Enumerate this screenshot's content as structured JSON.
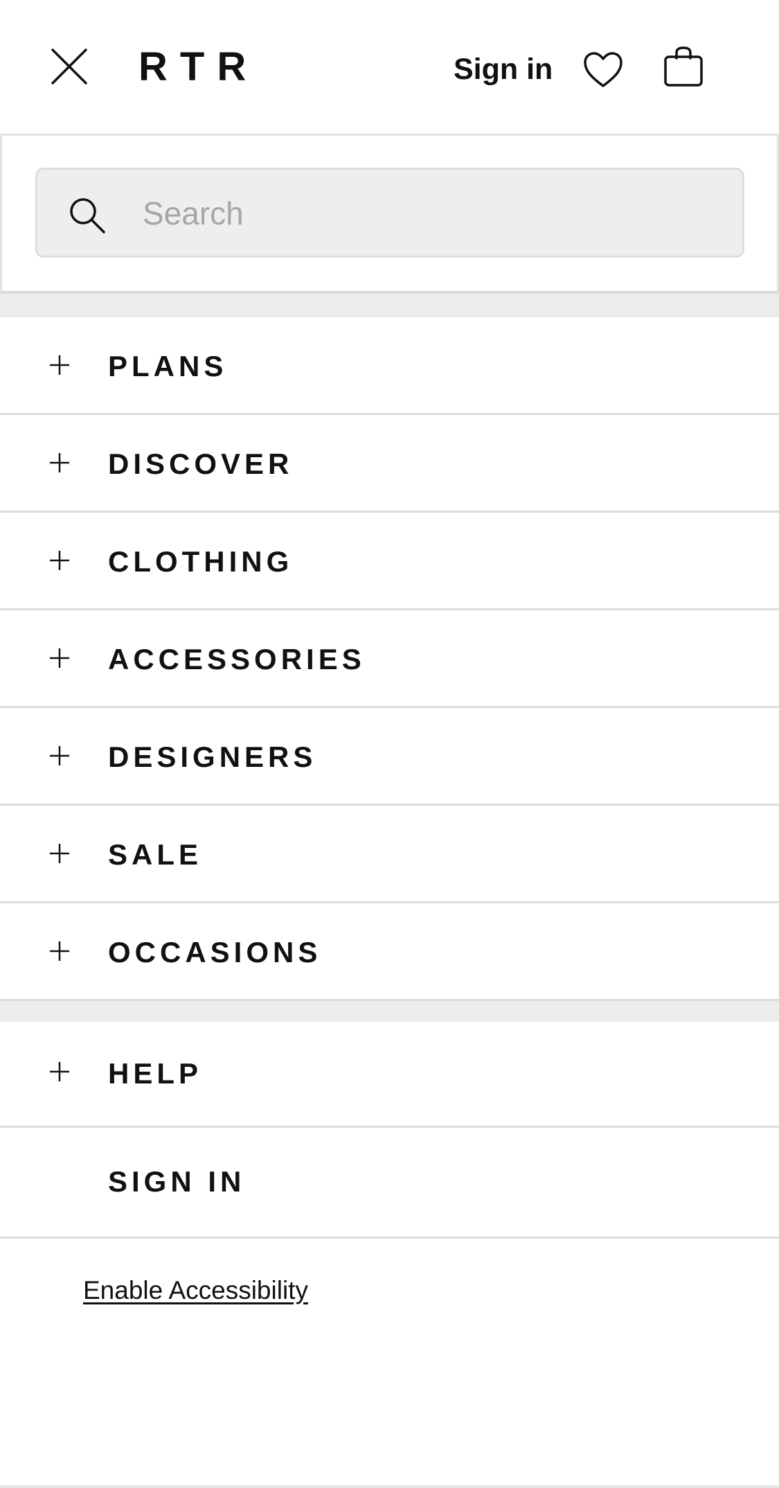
{
  "header": {
    "logo": "RTR",
    "sign_in_link": "Sign in",
    "icons": {
      "close": "close-icon",
      "favorites": "heart-icon",
      "bag": "shopping-bag-icon"
    }
  },
  "search": {
    "placeholder": "Search",
    "value": "",
    "icon": "search-icon"
  },
  "menu": {
    "items": [
      {
        "label": "PLANS",
        "icon": "plus-icon"
      },
      {
        "label": "DISCOVER",
        "icon": "plus-icon"
      },
      {
        "label": "CLOTHING",
        "icon": "plus-icon"
      },
      {
        "label": "ACCESSORIES",
        "icon": "plus-icon"
      },
      {
        "label": "DESIGNERS",
        "icon": "plus-icon"
      },
      {
        "label": "SALE",
        "icon": "plus-icon"
      },
      {
        "label": "OCCASIONS",
        "icon": "plus-icon"
      }
    ],
    "secondary": [
      {
        "label": "HELP",
        "icon": "plus-icon"
      },
      {
        "label": "SIGN IN"
      }
    ]
  },
  "footer": {
    "accessibility_link": "Enable Accessibility"
  },
  "colors": {
    "text": "#111111",
    "divider": "#dcdcdc",
    "band": "#ececec",
    "search_bg": "#eeeeee",
    "placeholder": "#a6a6a6"
  }
}
